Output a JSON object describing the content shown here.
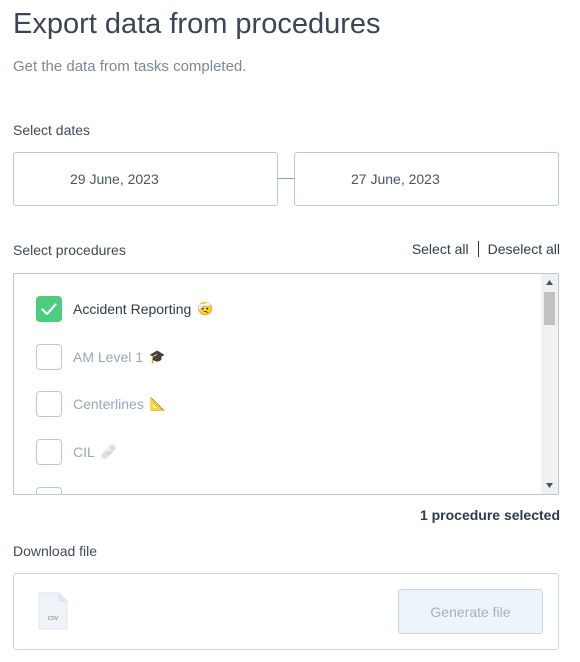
{
  "header": {
    "title": "Export data from procedures",
    "subtitle": "Get the data from tasks completed."
  },
  "dates": {
    "label": "Select dates",
    "start": "29 June, 2023",
    "end": "27 June, 2023"
  },
  "procedures": {
    "label": "Select procedures",
    "select_all": "Select all",
    "deselect_all": "Deselect all",
    "items": [
      {
        "label": "Accident Reporting",
        "emoji": "🤕",
        "checked": true
      },
      {
        "label": "AM Level 1",
        "emoji": "🎓",
        "checked": false
      },
      {
        "label": "Centerlines",
        "emoji": "📐",
        "checked": false
      },
      {
        "label": "CIL",
        "emoji": "🩹",
        "checked": false
      }
    ],
    "selected_count_text": "1 procedure selected"
  },
  "download": {
    "label": "Download file",
    "file_type": "csv",
    "button_label": "Generate file"
  },
  "colors": {
    "accent_green": "#4ccd7e",
    "border": "#b7c9d6"
  }
}
